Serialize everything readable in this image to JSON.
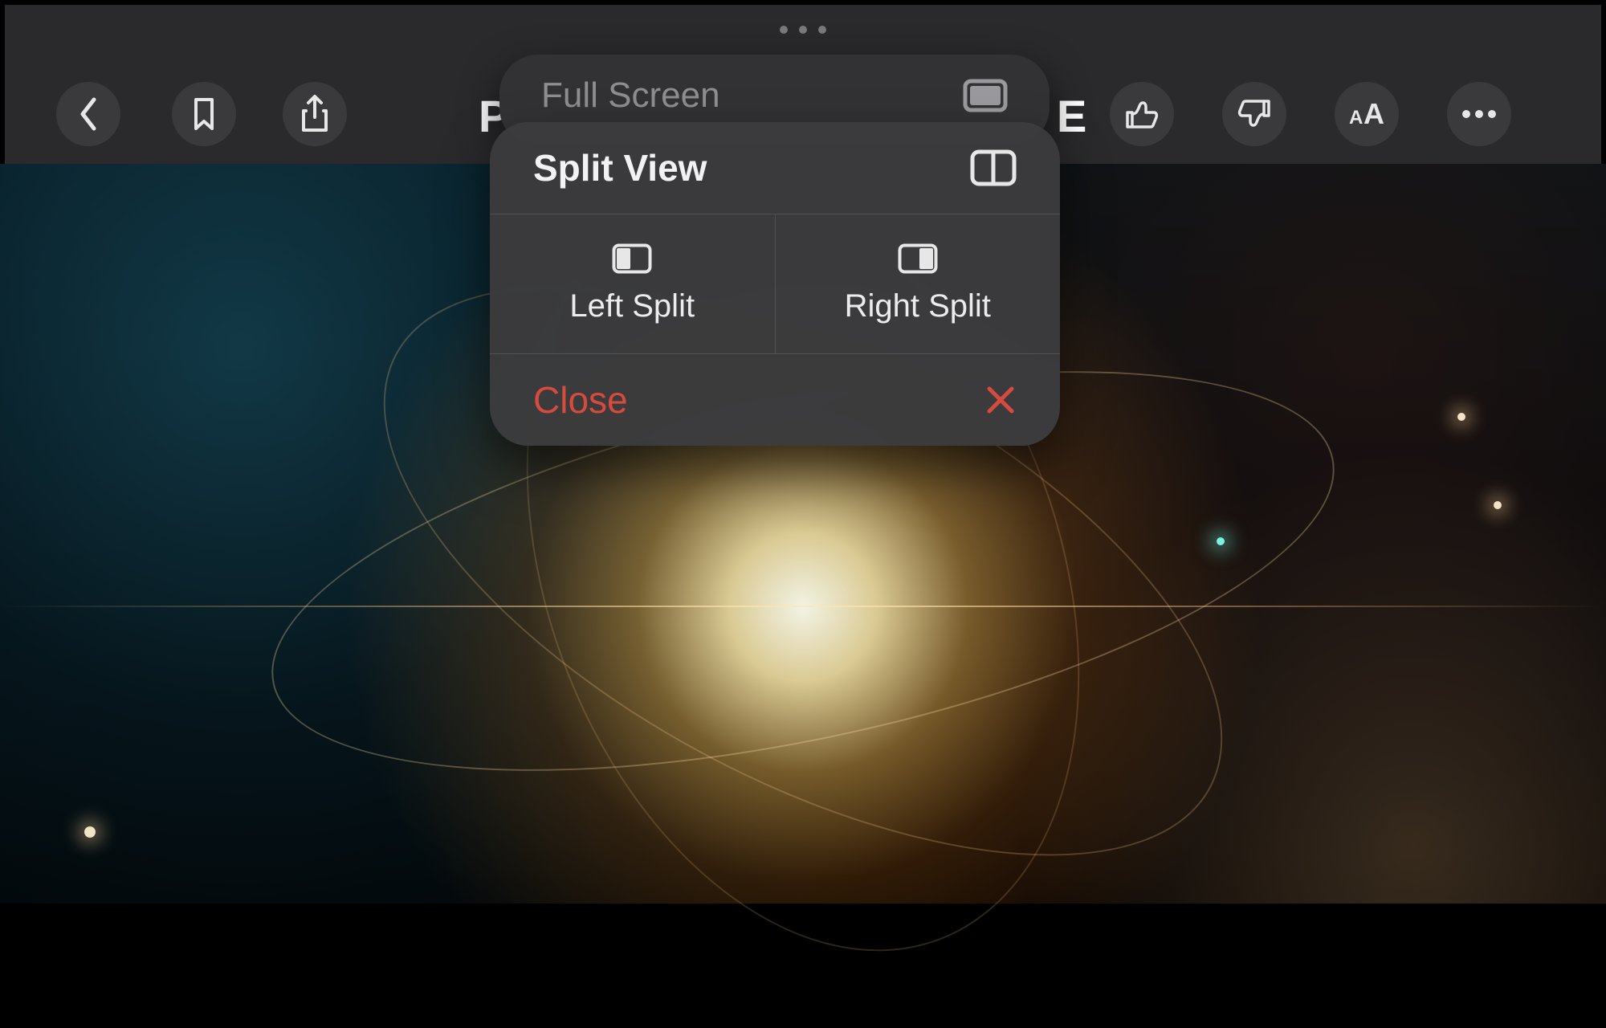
{
  "colors": {
    "toolbar_bg": "#2A2A2C",
    "button_bg": "#3A3A3C",
    "popup_bg": "#3B3B3D",
    "close_red": "#D74B3F",
    "muted_text": "#8E8E92"
  },
  "toolbar": {
    "icons": {
      "back": "chevron-left-icon",
      "bookmark": "bookmark-icon",
      "share": "share-icon",
      "like": "thumbs-up-icon",
      "dislike": "thumbs-down-icon",
      "textsize": "text-size-icon",
      "more": "ellipsis-icon"
    }
  },
  "title_fragments": {
    "left": "P",
    "right": "E"
  },
  "multitasking_menu": {
    "full_screen_label": "Full Screen",
    "split_view_label": "Split View",
    "left_split_label": "Left Split",
    "right_split_label": "Right Split",
    "close_label": "Close"
  }
}
